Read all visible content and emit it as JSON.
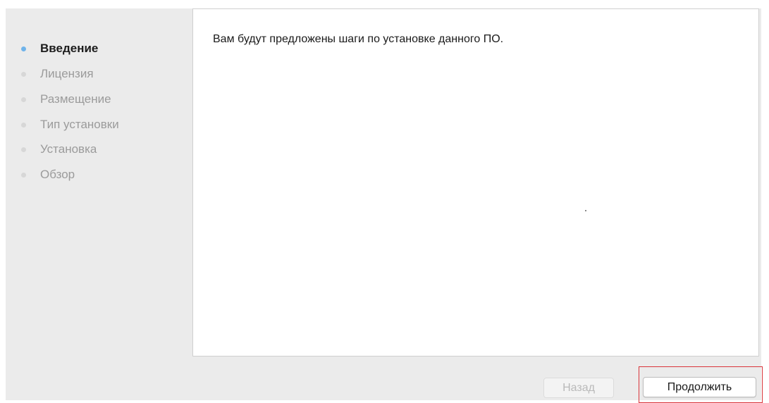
{
  "sidebar": {
    "steps": [
      {
        "label": "Введение",
        "active": true
      },
      {
        "label": "Лицензия",
        "active": false
      },
      {
        "label": "Размещение",
        "active": false
      },
      {
        "label": "Тип установки",
        "active": false
      },
      {
        "label": "Установка",
        "active": false
      },
      {
        "label": "Обзор",
        "active": false
      }
    ]
  },
  "content": {
    "text": "Вам будут предложены шаги по установке данного ПО."
  },
  "buttons": {
    "back_label": "Назад",
    "back_enabled": false,
    "continue_label": "Продолжить",
    "continue_highlight_color": "#d9343a"
  },
  "colors": {
    "active_dot": "#6fb3ea",
    "inactive_dot": "#d7d7d7",
    "panel_background": "#ebebeb"
  }
}
